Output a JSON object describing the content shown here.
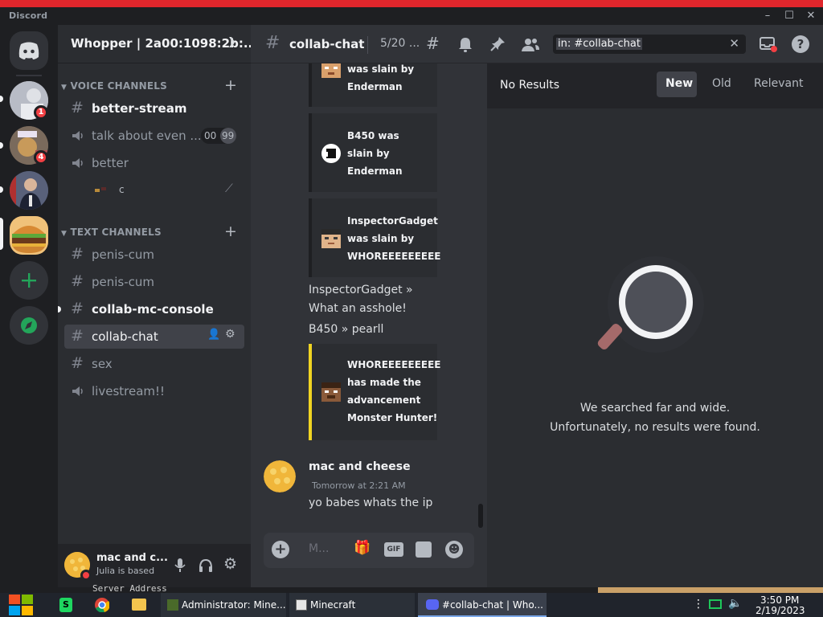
{
  "window": {
    "app_name": "Discord"
  },
  "servers": [
    {
      "name": "server-1",
      "badge": "1"
    },
    {
      "name": "server-2",
      "badge": "4"
    },
    {
      "name": "server-3"
    },
    {
      "name": "whopper-server"
    }
  ],
  "guild": {
    "name": "Whopper | 2a00:1098:2b:..."
  },
  "sidebar": {
    "voice_category": "VOICE CHANNELS",
    "voice_channels": [
      {
        "name": "better-stream"
      },
      {
        "name": "talk about even ...",
        "user_count": "00",
        "user_limit": "99"
      },
      {
        "name": "better"
      }
    ],
    "voice_user": {
      "name": "c"
    },
    "text_category": "TEXT CHANNELS",
    "text_channels": [
      {
        "name": "penis-cum"
      },
      {
        "name": "penis-cum"
      },
      {
        "name": "collab-mc-console"
      },
      {
        "name": "collab-chat"
      },
      {
        "name": "sex"
      },
      {
        "name": "livestream!!"
      }
    ]
  },
  "user_panel": {
    "name": "mac and c...",
    "status": "Julia is based"
  },
  "topbar": {
    "channel": "collab-chat",
    "topic": "5/20 ...",
    "search_query": "in: #collab-chat"
  },
  "messages": {
    "embeds": [
      {
        "lines": [
          "was slain by",
          "Enderman"
        ],
        "accent": "#1e1f22"
      },
      {
        "lines": [
          "B450 was",
          "slain by",
          "Enderman"
        ],
        "accent": "#1e1f22"
      },
      {
        "lines": [
          "InspectorGadget",
          "was slain by",
          "WHOREEEEEEEEE"
        ],
        "accent": "#1e1f22"
      },
      {
        "lines": [
          "WHOREEEEEEEEE",
          "has made the",
          "advancement",
          "Monster Hunter!"
        ],
        "accent": "#f0d422"
      }
    ],
    "relay_1": "InspectorGadget »",
    "relay_1b": "What an asshole!",
    "relay_2": "B450 » pearll",
    "author": "mac and cheese",
    "timestamp": "Tomorrow at 2:21 AM",
    "content": "yo babes whats the ip",
    "composer_placeholder": "M..."
  },
  "search_panel": {
    "no_results": "No Results",
    "sort_tabs": [
      "New",
      "Old",
      "Relevant"
    ],
    "empty_line_1": "We searched far and wide.",
    "empty_line_2": "Unfortunately, no results were found."
  },
  "background_text": "Server Address",
  "taskbar": {
    "apps": [
      "Administrator: Mine...",
      "Minecraft",
      "#collab-chat | Who..."
    ],
    "time": "3:50 PM",
    "date": "2/19/2023"
  }
}
